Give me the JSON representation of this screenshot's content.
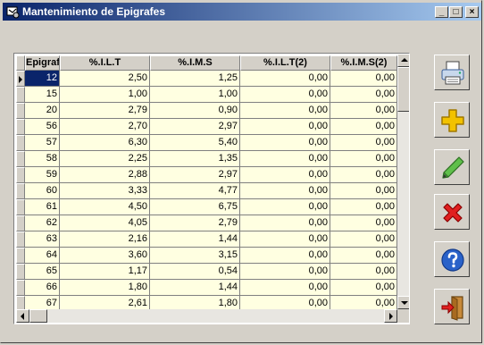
{
  "window": {
    "title": "Mantenimiento de Epigrafes",
    "minimize_glyph": "_",
    "maximize_glyph": "□",
    "close_glyph": "×"
  },
  "grid": {
    "columns": [
      "Epigrafe",
      "%.I.L.T",
      "%.I.M.S",
      "%.I.L.T(2)",
      "%.I.M.S(2)"
    ],
    "rows": [
      [
        "12",
        "2,50",
        "1,25",
        "0,00",
        "0,00"
      ],
      [
        "15",
        "1,00",
        "1,00",
        "0,00",
        "0,00"
      ],
      [
        "20",
        "2,79",
        "0,90",
        "0,00",
        "0,00"
      ],
      [
        "56",
        "2,70",
        "2,97",
        "0,00",
        "0,00"
      ],
      [
        "57",
        "6,30",
        "5,40",
        "0,00",
        "0,00"
      ],
      [
        "58",
        "2,25",
        "1,35",
        "0,00",
        "0,00"
      ],
      [
        "59",
        "2,88",
        "2,97",
        "0,00",
        "0,00"
      ],
      [
        "60",
        "3,33",
        "4,77",
        "0,00",
        "0,00"
      ],
      [
        "61",
        "4,50",
        "6,75",
        "0,00",
        "0,00"
      ],
      [
        "62",
        "4,05",
        "2,79",
        "0,00",
        "0,00"
      ],
      [
        "63",
        "2,16",
        "1,44",
        "0,00",
        "0,00"
      ],
      [
        "64",
        "3,60",
        "3,15",
        "0,00",
        "0,00"
      ],
      [
        "65",
        "1,17",
        "0,54",
        "0,00",
        "0,00"
      ],
      [
        "66",
        "1,80",
        "1,44",
        "0,00",
        "0,00"
      ],
      [
        "67",
        "2,61",
        "1,80",
        "0,00",
        "0,00"
      ]
    ],
    "selected_row": 0,
    "selected_col": 0
  },
  "toolbar": [
    {
      "name": "print-button",
      "icon": "printer-icon"
    },
    {
      "name": "add-button",
      "icon": "plus-icon"
    },
    {
      "name": "edit-button",
      "icon": "pencil-icon"
    },
    {
      "name": "delete-button",
      "icon": "delete-x-icon"
    },
    {
      "name": "help-button",
      "icon": "help-icon"
    },
    {
      "name": "exit-button",
      "icon": "exit-door-icon"
    }
  ],
  "colors": {
    "title_start": "#0a246a",
    "title_end": "#a6caf0",
    "cell_bg": "#ffffe1",
    "selection": "#0a246a"
  }
}
